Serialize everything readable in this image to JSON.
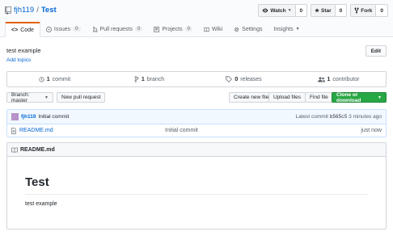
{
  "repo": {
    "owner": "fjh119",
    "separator": "/",
    "name": "Test"
  },
  "actions": [
    {
      "label": "Watch",
      "count": "0",
      "icon": "eye-icon"
    },
    {
      "label": "Star",
      "count": "0",
      "icon": "star-icon"
    },
    {
      "label": "Fork",
      "count": "0",
      "icon": "fork-icon"
    }
  ],
  "tabs": [
    {
      "label": "Code",
      "icon": "code-icon"
    },
    {
      "label": "Issues",
      "count": "0",
      "icon": "issue-icon"
    },
    {
      "label": "Pull requests",
      "count": "0",
      "icon": "pull-request-icon"
    },
    {
      "label": "Projects",
      "count": "0",
      "icon": "project-icon"
    },
    {
      "label": "Wiki",
      "icon": "book-icon"
    },
    {
      "label": "Settings",
      "icon": "gear-icon"
    },
    {
      "label": "Insights",
      "icon": "chevron-down-icon"
    }
  ],
  "description": "test example",
  "add_topics": "Add topics",
  "edit_label": "Edit",
  "stats": {
    "commits_num": "1",
    "commits_label": "commit",
    "branches_num": "1",
    "branches_label": "branch",
    "releases_num": "0",
    "releases_label": "releases",
    "contributors_num": "1",
    "contributors_label": "contributor"
  },
  "toolbar": {
    "branch_label": "Branch: master",
    "new_pr": "New pull request",
    "create_file": "Create new file",
    "upload_files": "Upload files",
    "find_file": "Find file",
    "clone": "Clone or download"
  },
  "commit": {
    "author": "fjh119",
    "message": "Initial commit",
    "latest_prefix": "Latest commit",
    "sha": "b565c5",
    "age": "3 minutes ago"
  },
  "files": [
    {
      "name": "README.md",
      "message": "Initial commit",
      "age": "just now"
    }
  ],
  "readme": {
    "title": "README.md",
    "heading": "Test",
    "body": "test example"
  },
  "colors": {
    "accent": "#0366d6",
    "tab_active": "#e36209",
    "clone_button": "#28a745"
  }
}
